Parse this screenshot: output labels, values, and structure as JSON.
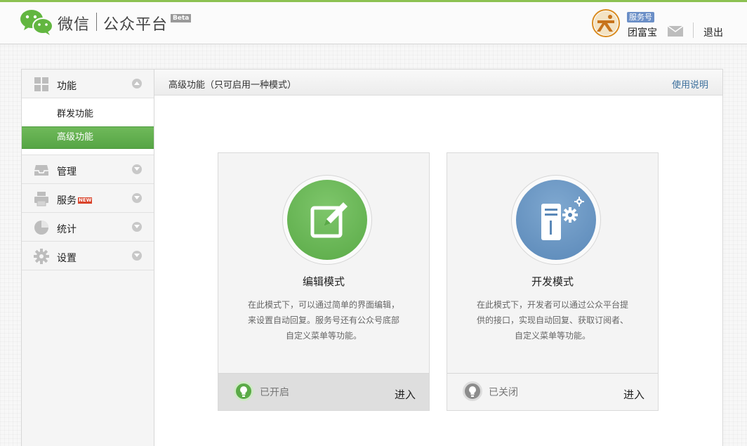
{
  "header": {
    "brand": "微信",
    "product": "公众平台",
    "beta_label": "Beta",
    "account_type": "服务号",
    "account_name": "团富宝",
    "logout": "退出"
  },
  "sidebar": {
    "sections": [
      {
        "label": "功能",
        "icon": "grid-icon",
        "expanded": true,
        "items": [
          {
            "label": "群发功能",
            "active": false
          },
          {
            "label": "高级功能",
            "active": true
          }
        ]
      },
      {
        "label": "管理",
        "icon": "inbox-icon"
      },
      {
        "label": "服务",
        "icon": "printer-icon",
        "badge": "NEW"
      },
      {
        "label": "统计",
        "icon": "pie-chart-icon"
      },
      {
        "label": "设置",
        "icon": "gear-icon"
      }
    ]
  },
  "content": {
    "title": "高级功能（只可启用一种模式）",
    "help_link": "使用说明",
    "cards": [
      {
        "title": "编辑模式",
        "desc_lines": [
          "在此模式下，可以通过简单的界面编辑，",
          "来设置自动回复。服务号还有公众号底部",
          "自定义菜单等功能。"
        ],
        "state": "已开启",
        "enter": "进入",
        "icon": "edit-icon",
        "color": "#5aaa47"
      },
      {
        "title": "开发模式",
        "desc_lines": [
          "在此模式下，开发者可以通过公众平台提",
          "供的接口，实现自动回复、获取订阅者、",
          "自定义菜单等功能。"
        ],
        "state": "已关闭",
        "enter": "进入",
        "icon": "server-gear-icon",
        "color": "#5a88b8"
      }
    ]
  },
  "colors": {
    "accent_green": "#8cc152",
    "active_green": "#56a545",
    "link_blue": "#3c6f9c"
  }
}
